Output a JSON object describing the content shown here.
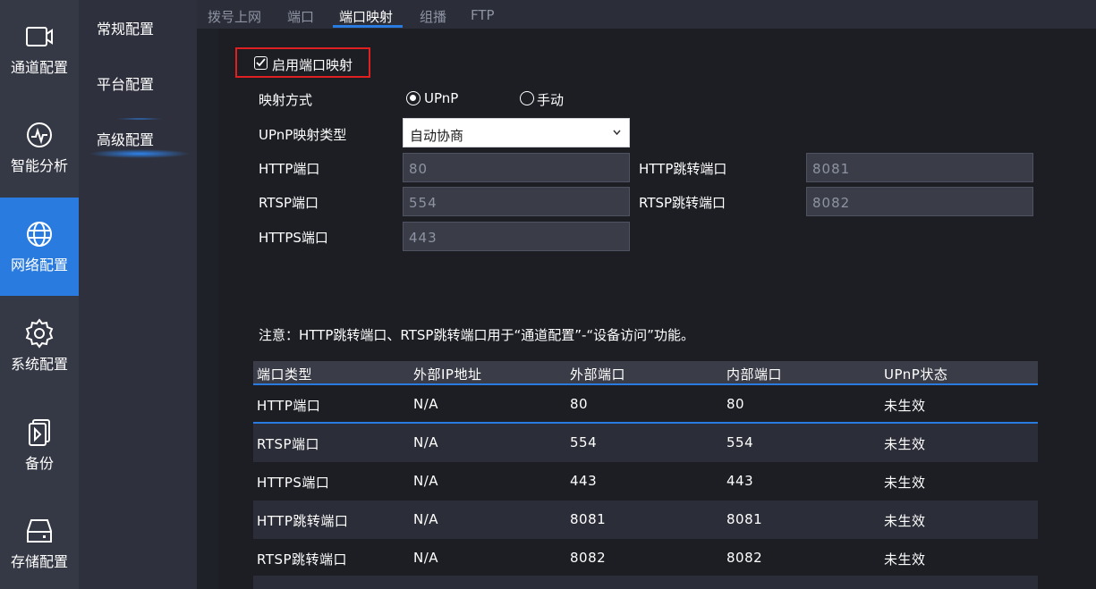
{
  "rail": [
    {
      "label": "通道配置",
      "icon": "video-camera-icon"
    },
    {
      "label": "智能分析",
      "icon": "analytics-icon"
    },
    {
      "label": "网络配置",
      "icon": "globe-icon"
    },
    {
      "label": "系统配置",
      "icon": "gear-icon"
    },
    {
      "label": "备份",
      "icon": "backup-icon"
    },
    {
      "label": "存储配置",
      "icon": "hard-drive-icon"
    }
  ],
  "submenu": [
    {
      "label": "常规配置"
    },
    {
      "label": "平台配置"
    },
    {
      "label": "高级配置"
    }
  ],
  "tabs": [
    {
      "label": "拨号上网"
    },
    {
      "label": "端口"
    },
    {
      "label": "端口映射"
    },
    {
      "label": "组播"
    },
    {
      "label": "FTP"
    }
  ],
  "form": {
    "enable_label": "启用端口映射",
    "mapping_mode_label": "映射方式",
    "mode_upnp": "UPnP",
    "mode_manual": "手动",
    "upnp_type_label": "UPnP映射类型",
    "upnp_type_value": "自动协商",
    "http_port_label": "HTTP端口",
    "http_port_value": "80",
    "http_redirect_label": "HTTP跳转端口",
    "http_redirect_value": "8081",
    "rtsp_port_label": "RTSP端口",
    "rtsp_port_value": "554",
    "rtsp_redirect_label": "RTSP跳转端口",
    "rtsp_redirect_value": "8082",
    "https_port_label": "HTTPS端口",
    "https_port_value": "443"
  },
  "note": "注意：HTTP跳转端口、RTSP跳转端口用于“通道配置”-“设备访问”功能。",
  "table": {
    "headers": [
      "端口类型",
      "外部IP地址",
      "外部端口",
      "内部端口",
      "UPnP状态"
    ],
    "rows": [
      [
        "HTTP端口",
        "N/A",
        "80",
        "80",
        "未生效"
      ],
      [
        "RTSP端口",
        "N/A",
        "554",
        "554",
        "未生效"
      ],
      [
        "HTTPS端口",
        "N/A",
        "443",
        "443",
        "未生效"
      ],
      [
        "HTTP跳转端口",
        "N/A",
        "8081",
        "8081",
        "未生效"
      ],
      [
        "RTSP跳转端口",
        "N/A",
        "8082",
        "8082",
        "未生效"
      ]
    ]
  },
  "colors": {
    "accent": "#2a7be0",
    "highlight_border": "#e02020"
  }
}
